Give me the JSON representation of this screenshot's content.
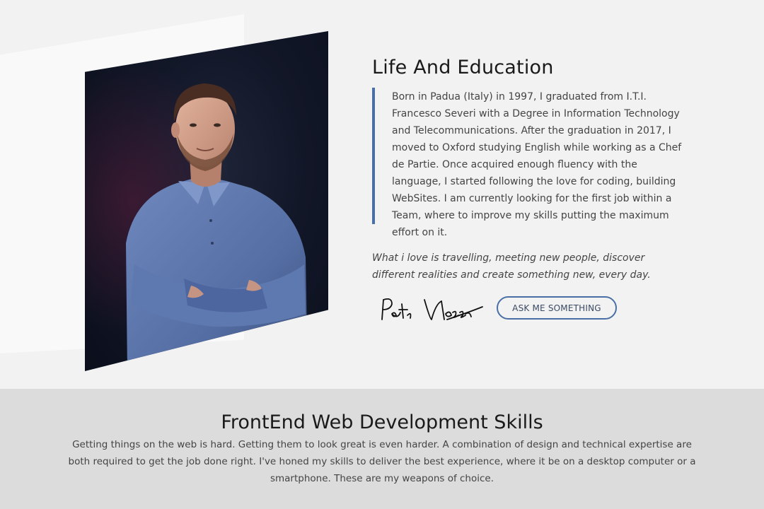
{
  "about": {
    "title": "Life And Education",
    "bio": "Born in Padua (Italy) in 1997, I graduated from I.T.I. Francesco Severi with a Degree in Information Technology and Telecommunications. After the graduation in 2017, I moved to Oxford studying English while working as a Chef de Partie. Once acquired enough fluency with the language, I started following the love for coding, building WebSites. I am currently looking for the first job within a Team, where to improve my skills putting the maximum effort on it.",
    "quote": "What i love is travelling, meeting new people, discover different realities and create something new, every day.",
    "signature_text": "Peter Vlessio",
    "ask_button_label": "ASK ME SOMETHING",
    "accent_color": "#4a6fa5"
  },
  "skills": {
    "title": "FrontEnd Web Development Skills",
    "description": "Getting things on the web is hard. Getting them to look great is even harder. A combination of design and technical expertise are both required to get the job done right. I've honed my skills to deliver the best experience, where it be on a desktop computer or a smartphone. These are my weapons of choice."
  }
}
